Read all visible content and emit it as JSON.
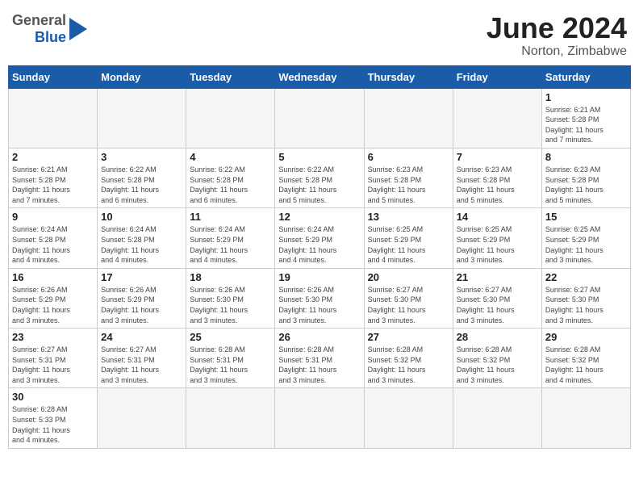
{
  "header": {
    "logo_general": "General",
    "logo_blue": "Blue",
    "month_year": "June 2024",
    "location": "Norton, Zimbabwe"
  },
  "weekdays": [
    "Sunday",
    "Monday",
    "Tuesday",
    "Wednesday",
    "Thursday",
    "Friday",
    "Saturday"
  ],
  "weeks": [
    [
      {
        "day": "",
        "info": ""
      },
      {
        "day": "",
        "info": ""
      },
      {
        "day": "",
        "info": ""
      },
      {
        "day": "",
        "info": ""
      },
      {
        "day": "",
        "info": ""
      },
      {
        "day": "",
        "info": ""
      },
      {
        "day": "1",
        "info": "Sunrise: 6:21 AM\nSunset: 5:28 PM\nDaylight: 11 hours\nand 7 minutes."
      }
    ],
    [
      {
        "day": "2",
        "info": "Sunrise: 6:21 AM\nSunset: 5:28 PM\nDaylight: 11 hours\nand 7 minutes."
      },
      {
        "day": "3",
        "info": "Sunrise: 6:22 AM\nSunset: 5:28 PM\nDaylight: 11 hours\nand 6 minutes."
      },
      {
        "day": "4",
        "info": "Sunrise: 6:22 AM\nSunset: 5:28 PM\nDaylight: 11 hours\nand 6 minutes."
      },
      {
        "day": "5",
        "info": "Sunrise: 6:22 AM\nSunset: 5:28 PM\nDaylight: 11 hours\nand 5 minutes."
      },
      {
        "day": "6",
        "info": "Sunrise: 6:23 AM\nSunset: 5:28 PM\nDaylight: 11 hours\nand 5 minutes."
      },
      {
        "day": "7",
        "info": "Sunrise: 6:23 AM\nSunset: 5:28 PM\nDaylight: 11 hours\nand 5 minutes."
      },
      {
        "day": "8",
        "info": "Sunrise: 6:23 AM\nSunset: 5:28 PM\nDaylight: 11 hours\nand 5 minutes."
      }
    ],
    [
      {
        "day": "9",
        "info": "Sunrise: 6:24 AM\nSunset: 5:28 PM\nDaylight: 11 hours\nand 4 minutes."
      },
      {
        "day": "10",
        "info": "Sunrise: 6:24 AM\nSunset: 5:28 PM\nDaylight: 11 hours\nand 4 minutes."
      },
      {
        "day": "11",
        "info": "Sunrise: 6:24 AM\nSunset: 5:29 PM\nDaylight: 11 hours\nand 4 minutes."
      },
      {
        "day": "12",
        "info": "Sunrise: 6:24 AM\nSunset: 5:29 PM\nDaylight: 11 hours\nand 4 minutes."
      },
      {
        "day": "13",
        "info": "Sunrise: 6:25 AM\nSunset: 5:29 PM\nDaylight: 11 hours\nand 4 minutes."
      },
      {
        "day": "14",
        "info": "Sunrise: 6:25 AM\nSunset: 5:29 PM\nDaylight: 11 hours\nand 3 minutes."
      },
      {
        "day": "15",
        "info": "Sunrise: 6:25 AM\nSunset: 5:29 PM\nDaylight: 11 hours\nand 3 minutes."
      }
    ],
    [
      {
        "day": "16",
        "info": "Sunrise: 6:26 AM\nSunset: 5:29 PM\nDaylight: 11 hours\nand 3 minutes."
      },
      {
        "day": "17",
        "info": "Sunrise: 6:26 AM\nSunset: 5:29 PM\nDaylight: 11 hours\nand 3 minutes."
      },
      {
        "day": "18",
        "info": "Sunrise: 6:26 AM\nSunset: 5:30 PM\nDaylight: 11 hours\nand 3 minutes."
      },
      {
        "day": "19",
        "info": "Sunrise: 6:26 AM\nSunset: 5:30 PM\nDaylight: 11 hours\nand 3 minutes."
      },
      {
        "day": "20",
        "info": "Sunrise: 6:27 AM\nSunset: 5:30 PM\nDaylight: 11 hours\nand 3 minutes."
      },
      {
        "day": "21",
        "info": "Sunrise: 6:27 AM\nSunset: 5:30 PM\nDaylight: 11 hours\nand 3 minutes."
      },
      {
        "day": "22",
        "info": "Sunrise: 6:27 AM\nSunset: 5:30 PM\nDaylight: 11 hours\nand 3 minutes."
      }
    ],
    [
      {
        "day": "23",
        "info": "Sunrise: 6:27 AM\nSunset: 5:31 PM\nDaylight: 11 hours\nand 3 minutes."
      },
      {
        "day": "24",
        "info": "Sunrise: 6:27 AM\nSunset: 5:31 PM\nDaylight: 11 hours\nand 3 minutes."
      },
      {
        "day": "25",
        "info": "Sunrise: 6:28 AM\nSunset: 5:31 PM\nDaylight: 11 hours\nand 3 minutes."
      },
      {
        "day": "26",
        "info": "Sunrise: 6:28 AM\nSunset: 5:31 PM\nDaylight: 11 hours\nand 3 minutes."
      },
      {
        "day": "27",
        "info": "Sunrise: 6:28 AM\nSunset: 5:32 PM\nDaylight: 11 hours\nand 3 minutes."
      },
      {
        "day": "28",
        "info": "Sunrise: 6:28 AM\nSunset: 5:32 PM\nDaylight: 11 hours\nand 3 minutes."
      },
      {
        "day": "29",
        "info": "Sunrise: 6:28 AM\nSunset: 5:32 PM\nDaylight: 11 hours\nand 4 minutes."
      }
    ],
    [
      {
        "day": "30",
        "info": "Sunrise: 6:28 AM\nSunset: 5:33 PM\nDaylight: 11 hours\nand 4 minutes."
      },
      {
        "day": "",
        "info": ""
      },
      {
        "day": "",
        "info": ""
      },
      {
        "day": "",
        "info": ""
      },
      {
        "day": "",
        "info": ""
      },
      {
        "day": "",
        "info": ""
      },
      {
        "day": "",
        "info": ""
      }
    ]
  ]
}
